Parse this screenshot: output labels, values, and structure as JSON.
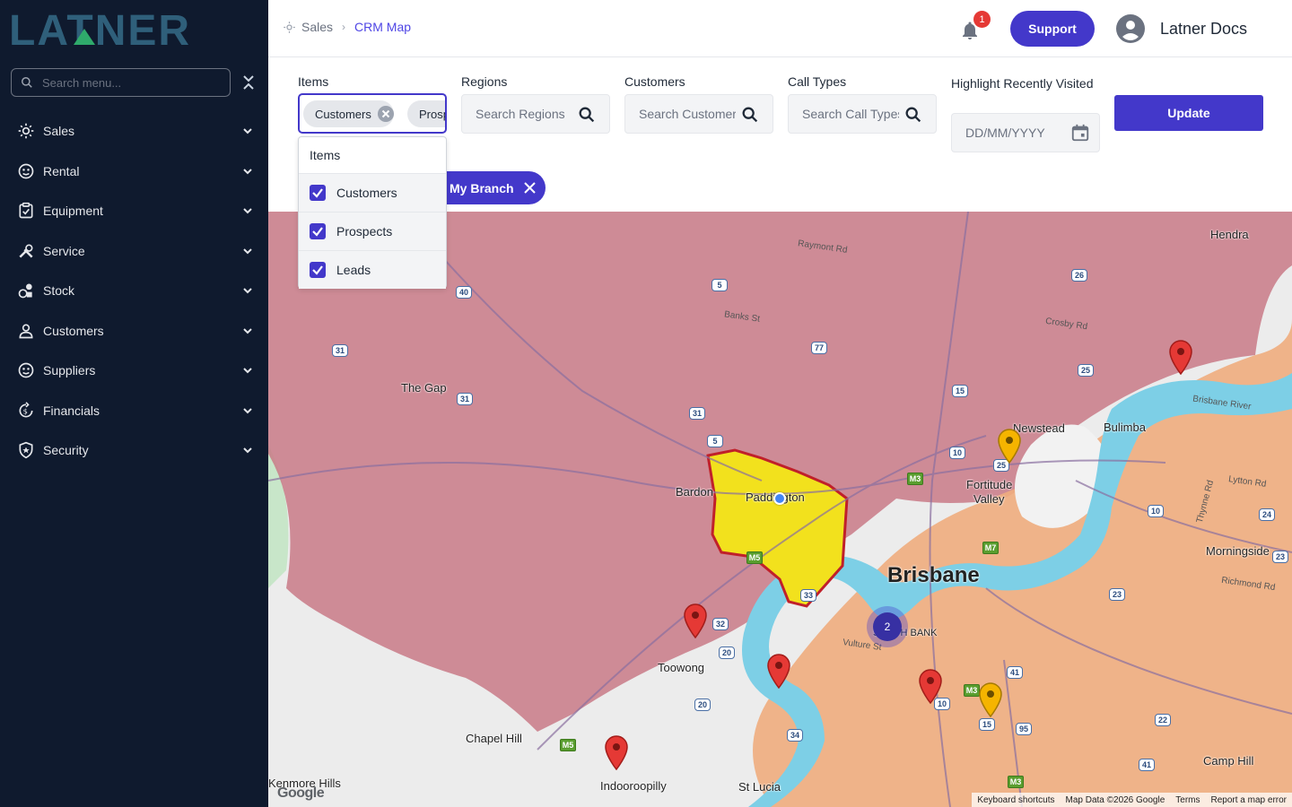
{
  "app": {
    "logo_text": "LATNER",
    "colors": {
      "sidebar_bg": "#0f1a2e",
      "accent": "#4338ca",
      "logo": "#2f5f7a"
    }
  },
  "sidebar": {
    "search_placeholder": "Search menu...",
    "items": [
      {
        "label": "Sales",
        "icon": "sales-icon"
      },
      {
        "label": "Rental",
        "icon": "rental-icon"
      },
      {
        "label": "Equipment",
        "icon": "equipment-icon"
      },
      {
        "label": "Service",
        "icon": "service-icon"
      },
      {
        "label": "Stock",
        "icon": "stock-icon"
      },
      {
        "label": "Customers",
        "icon": "customers-icon"
      },
      {
        "label": "Suppliers",
        "icon": "suppliers-icon"
      },
      {
        "label": "Financials",
        "icon": "financials-icon"
      },
      {
        "label": "Security",
        "icon": "security-icon"
      }
    ]
  },
  "header": {
    "breadcrumb": {
      "parent": "Sales",
      "current": "CRM Map"
    },
    "notification_count": "1",
    "support_label": "Support",
    "user_name": "Latner Docs"
  },
  "filters": {
    "items": {
      "label": "Items",
      "chips": [
        "Customers",
        "Prospects"
      ]
    },
    "regions": {
      "label": "Regions",
      "placeholder": "Search Regions"
    },
    "customers": {
      "label": "Customers",
      "placeholder": "Search Customers"
    },
    "call_types": {
      "label": "Call Types",
      "placeholder": "Search Call Types"
    },
    "recent": {
      "label": "Highlight Recently Visited",
      "placeholder": "DD/MM/YYYY"
    },
    "update_label": "Update",
    "branch_chip": "My Branch"
  },
  "dropdown": {
    "header": "Items",
    "options": [
      {
        "label": "Customers",
        "checked": true
      },
      {
        "label": "Prospects",
        "checked": true
      },
      {
        "label": "Leads",
        "checked": true
      }
    ]
  },
  "map": {
    "places": {
      "hendra": "Hendra",
      "raymont": "Raymont Rd",
      "banks": "Banks St",
      "crosby": "Crosby Rd",
      "thegap": "The Gap",
      "newstead": "Newstead",
      "bulimba": "Bulimba",
      "brisbane_river": "Brisbane River",
      "fortitude": "Fortitude",
      "valley": "Valley",
      "lytton": "Lytton Rd",
      "bardon": "Bardon",
      "paddington": "Paddington",
      "thynne": "Thynne Rd",
      "morningside": "Morningside",
      "brisbane": "Brisbane",
      "richmond": "Richmond Rd",
      "southbank": "SOUTH BANK",
      "vulture": "Vulture St",
      "toowong": "Toowong",
      "chapelhill": "Chapel Hill",
      "camphill": "Camp Hill",
      "kenmore": "Kenmore Hills",
      "indooroopilly": "Indooroopilly",
      "stlucia": "St Lucia"
    },
    "cluster_count": "2",
    "google_logo": "Google",
    "attribution": [
      "Keyboard shortcuts",
      "Map Data ©2026 Google",
      "Terms",
      "Report a map error"
    ]
  }
}
